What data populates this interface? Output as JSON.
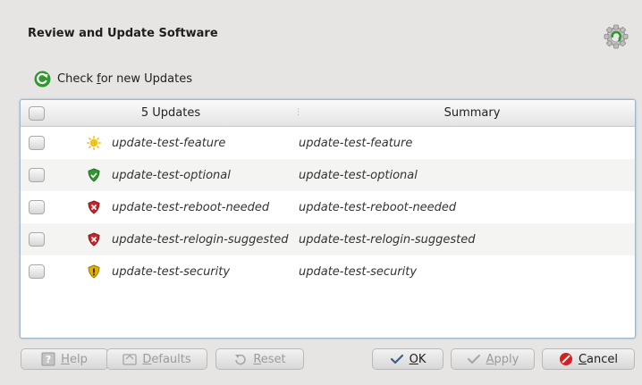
{
  "window": {
    "title": "Review and Update Software"
  },
  "toolbar": {
    "check_updates_label_pre": "Check ",
    "check_updates_label_mnemonic": "f",
    "check_updates_label_post": "or new Updates"
  },
  "table": {
    "header": {
      "name": "5 Updates",
      "summary": "Summary"
    },
    "rows": [
      {
        "name": "update-test-feature",
        "summary": "update-test-feature",
        "icon": "feature-icon",
        "checked": false
      },
      {
        "name": "update-test-optional",
        "summary": "update-test-optional",
        "icon": "optional-shield-icon",
        "checked": false
      },
      {
        "name": "update-test-reboot-needed",
        "summary": "update-test-reboot-needed",
        "icon": "critical-shield-icon",
        "checked": false
      },
      {
        "name": "update-test-relogin-suggested",
        "summary": "update-test-relogin-suggested",
        "icon": "critical-shield-icon",
        "checked": false
      },
      {
        "name": "update-test-security",
        "summary": "update-test-security",
        "icon": "security-shield-icon",
        "checked": false
      }
    ]
  },
  "buttons": {
    "help": {
      "mnemonic": "H",
      "rest": "elp",
      "enabled": false
    },
    "defaults": {
      "mnemonic": "D",
      "rest": "efaults",
      "enabled": false
    },
    "reset": {
      "mnemonic": "R",
      "rest": "eset",
      "enabled": false
    },
    "ok": {
      "mnemonic": "O",
      "rest": "K",
      "enabled": true
    },
    "apply": {
      "mnemonic": "A",
      "rest": "pply",
      "enabled": false
    },
    "cancel": {
      "mnemonic": "C",
      "rest": "ancel",
      "enabled": true
    }
  },
  "colors": {
    "accent_border": "#9fb6c8",
    "optional_shield": "#2f9a2f",
    "critical_shield": "#c8272a",
    "security_shield": "#e0b000",
    "feature_sun": "#f3c21a",
    "cancel_red": "#d42020",
    "check_green": "#2d9a2d"
  }
}
